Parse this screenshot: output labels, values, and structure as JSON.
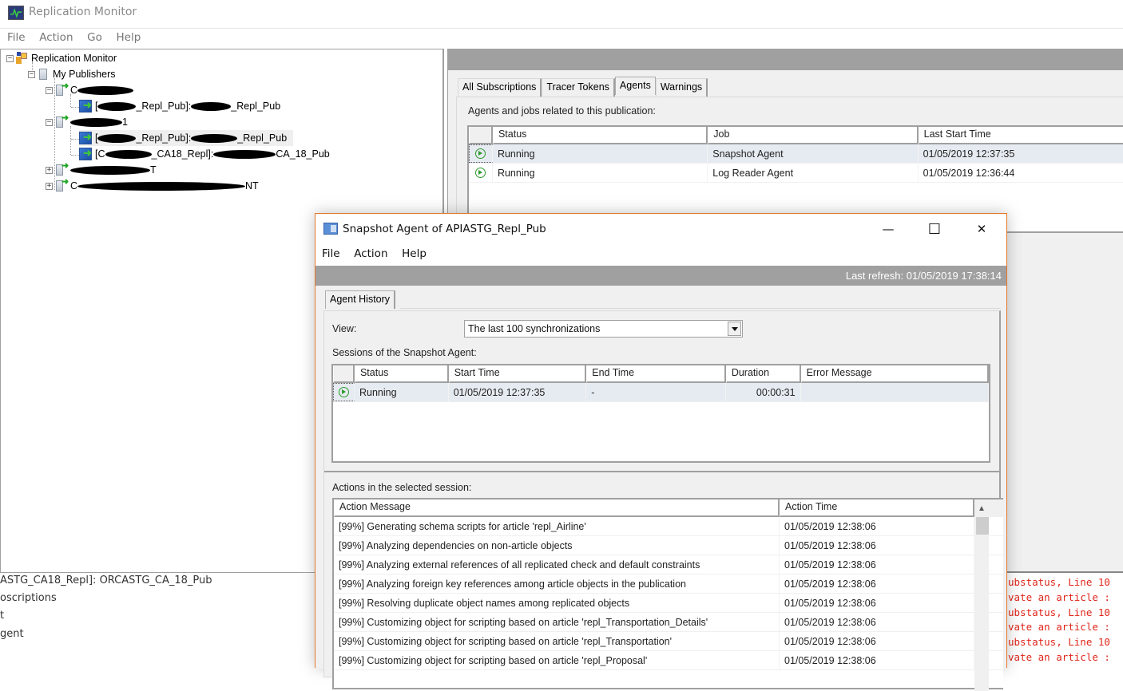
{
  "main_window": {
    "title": "Replication Monitor",
    "menu": [
      "File",
      "Action",
      "Go",
      "Help"
    ]
  },
  "tree": {
    "root": "Replication Monitor",
    "publishers_node": "My Publishers",
    "items": [
      {
        "type": "server",
        "expanded": true,
        "label_prefix": "C",
        "label_suffix": "",
        "redacted": true
      },
      {
        "type": "publication",
        "label_prefix": "[",
        "label_mid": "_Repl_Pub]: ",
        "label_suffix": "_Repl_Pub",
        "redacted": true
      },
      {
        "type": "server",
        "expanded": true,
        "label_prefix": "",
        "label_suffix": "1",
        "redacted": true
      },
      {
        "type": "publication",
        "selected": true,
        "label_prefix": "[",
        "label_mid": "_Repl_Pub]: ",
        "label_suffix": "_Repl_Pub",
        "redacted": true
      },
      {
        "type": "publication",
        "label_prefix": "[C",
        "label_mid": "_CA18_Repl]: ",
        "label_suffix": "CA_18_Pub",
        "redacted": true
      },
      {
        "type": "server",
        "expanded": false,
        "label_prefix": "",
        "label_suffix": "T",
        "redacted": true
      },
      {
        "type": "server",
        "expanded": false,
        "label_prefix": "C",
        "label_suffix": "NT",
        "redacted": true
      }
    ]
  },
  "right_panel": {
    "tabs": [
      "All Subscriptions",
      "Tracer Tokens",
      "Agents",
      "Warnings"
    ],
    "active_tab": "Agents",
    "section_label": "Agents and jobs related to this publication:",
    "columns": [
      "Status",
      "Job",
      "Last Start Time"
    ],
    "rows": [
      {
        "status": "Running",
        "job": "Snapshot Agent",
        "last_start": "01/05/2019 12:37:35",
        "selected": true
      },
      {
        "status": "Running",
        "job": "Log Reader Agent",
        "last_start": "01/05/2019 12:36:44",
        "selected": false
      }
    ]
  },
  "background_text": {
    "left_lines": [
      "ASTG_CA18_Repl]: ORCASTG_CA_18_Pub",
      "oscriptions",
      "t",
      "gent"
    ],
    "error_lines": [
      "ubstatus, Line 10",
      "vate an article :",
      "ubstatus, Line 10",
      "vate an article :",
      "ubstatus, Line 10",
      "vate an article :"
    ],
    "error_color": "#e0261b"
  },
  "dialog": {
    "title": "Snapshot Agent of APIASTG_Repl_Pub",
    "window_buttons": {
      "minimize": "—",
      "maximize": "☐",
      "close": "✕"
    },
    "menu": [
      "File",
      "Action",
      "Help"
    ],
    "last_refresh": "Last refresh: 01/05/2019 17:38:14",
    "tab": "Agent History",
    "view_label": "View:",
    "view_value": "The last 100 synchronizations",
    "sessions_label": "Sessions of the Snapshot Agent:",
    "session_columns": [
      "Status",
      "Start Time",
      "End Time",
      "Duration",
      "Error Message"
    ],
    "sessions": [
      {
        "status": "Running",
        "start": "01/05/2019 12:37:35",
        "end": "-",
        "duration": "00:00:31",
        "error": ""
      }
    ],
    "actions_label": "Actions in the selected session:",
    "action_columns": [
      "Action Message",
      "Action Time"
    ],
    "actions": [
      {
        "message": "[99%] Generating schema scripts for article 'repl_Airline'",
        "time": "01/05/2019 12:38:06"
      },
      {
        "message": "[99%] Analyzing dependencies on non-article objects",
        "time": "01/05/2019 12:38:06"
      },
      {
        "message": "[99%] Analyzing external references of all replicated check and default constraints",
        "time": "01/05/2019 12:38:06"
      },
      {
        "message": "[99%] Analyzing foreign key references among article objects in the publication",
        "time": "01/05/2019 12:38:06"
      },
      {
        "message": "[99%] Resolving duplicate object names among replicated objects",
        "time": "01/05/2019 12:38:06"
      },
      {
        "message": "[99%] Customizing object for scripting based on article 'repl_Transportation_Details'",
        "time": "01/05/2019 12:38:06"
      },
      {
        "message": "[99%] Customizing object for scripting based on article 'repl_Transportation'",
        "time": "01/05/2019 12:38:06"
      },
      {
        "message": "[99%] Customizing object for scripting based on article 'repl_Proposal'",
        "time": "01/05/2019 12:38:06"
      }
    ]
  }
}
